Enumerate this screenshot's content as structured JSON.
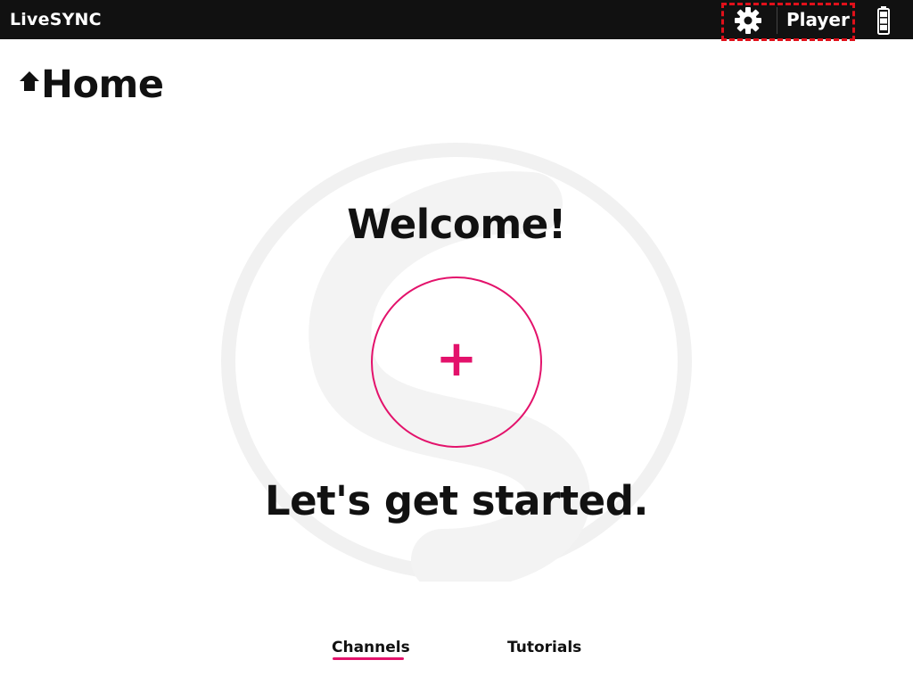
{
  "app": {
    "title": "LiveSYNC"
  },
  "topbar": {
    "settings_icon": "gear-icon",
    "player_label": "Player",
    "battery_icon": "battery-icon"
  },
  "page": {
    "title": "Home",
    "title_icon": "home-up-icon"
  },
  "main": {
    "welcome": "Welcome!",
    "add_icon": "+",
    "subtitle": "Let's get started.",
    "watermark_icon": "livesync-logo-watermark"
  },
  "tabs": [
    {
      "label": "Channels",
      "active": true
    },
    {
      "label": "Tutorials",
      "active": false
    }
  ],
  "colors": {
    "accent": "#e3126b",
    "topbar": "#111111",
    "highlight": "#e0101a"
  }
}
